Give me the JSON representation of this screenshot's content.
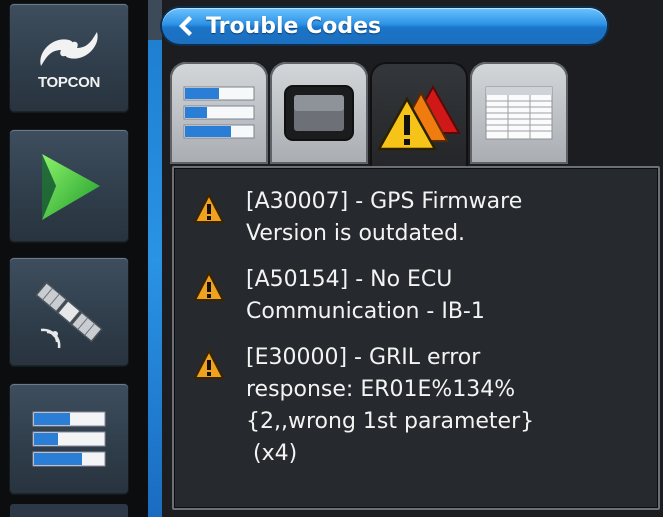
{
  "app": {
    "brand": "TOPCON"
  },
  "sidebar": {
    "items": [
      {
        "name": "logo",
        "icon": "topcon-logo-icon"
      },
      {
        "name": "play",
        "icon": "play-triangle-icon"
      },
      {
        "name": "gps",
        "icon": "satellite-icon"
      },
      {
        "name": "list",
        "icon": "list-bars-icon"
      }
    ]
  },
  "header": {
    "title": "Trouble Codes",
    "back_icon": "chevron-left-icon"
  },
  "tabs": [
    {
      "id": "settings",
      "icon": "list-bars-icon",
      "active": false
    },
    {
      "id": "display",
      "icon": "monitor-icon",
      "active": false
    },
    {
      "id": "warnings",
      "icon": "stacked-warning-icon",
      "active": true
    },
    {
      "id": "log",
      "icon": "document-table-icon",
      "active": false
    }
  ],
  "codes": [
    {
      "text": "[A30007] - GPS Firmware\nVersion is outdated."
    },
    {
      "text": "[A50154] - No ECU\nCommunication - IB-1"
    },
    {
      "text": "[E30000] - GRIL error\nresponse: ER01E%134%\n{2,,wrong 1st parameter}\n (x4)"
    }
  ],
  "colors": {
    "accent_blue": "#2d93e6",
    "warning_orange": "#f0a21e",
    "panel_bg": "#26292d"
  }
}
